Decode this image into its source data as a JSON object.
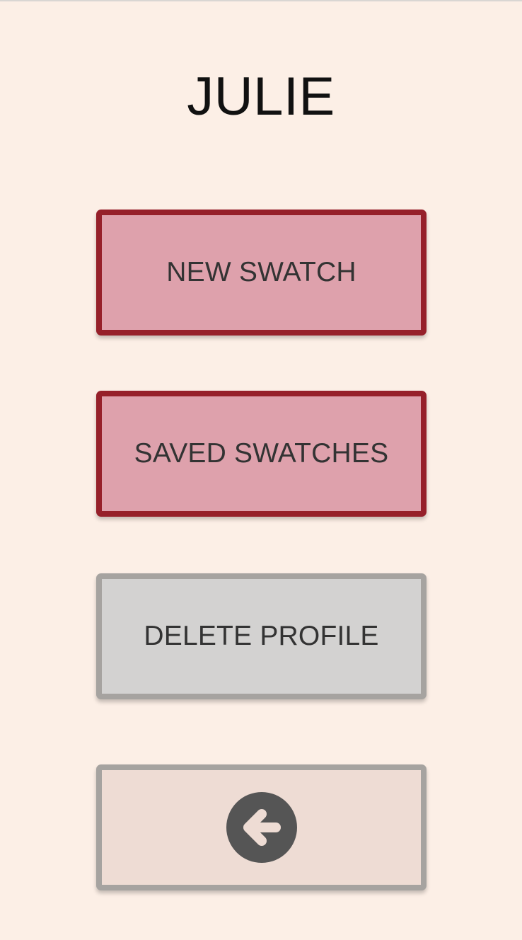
{
  "profile": {
    "name": "JULIE"
  },
  "menu": {
    "new_swatch_label": "NEW SWATCH",
    "saved_swatches_label": "SAVED SWATCHES",
    "delete_profile_label": "DELETE PROFILE",
    "back_icon": "arrow-left-circle-icon"
  },
  "colors": {
    "background": "#fcefe6",
    "primary_fill": "#dea1ac",
    "primary_border": "#96202a",
    "neutral_fill": "#d3d2d1",
    "neutral_border": "#a6a3a0",
    "back_fill": "#eedcd4",
    "icon": "#555555"
  }
}
